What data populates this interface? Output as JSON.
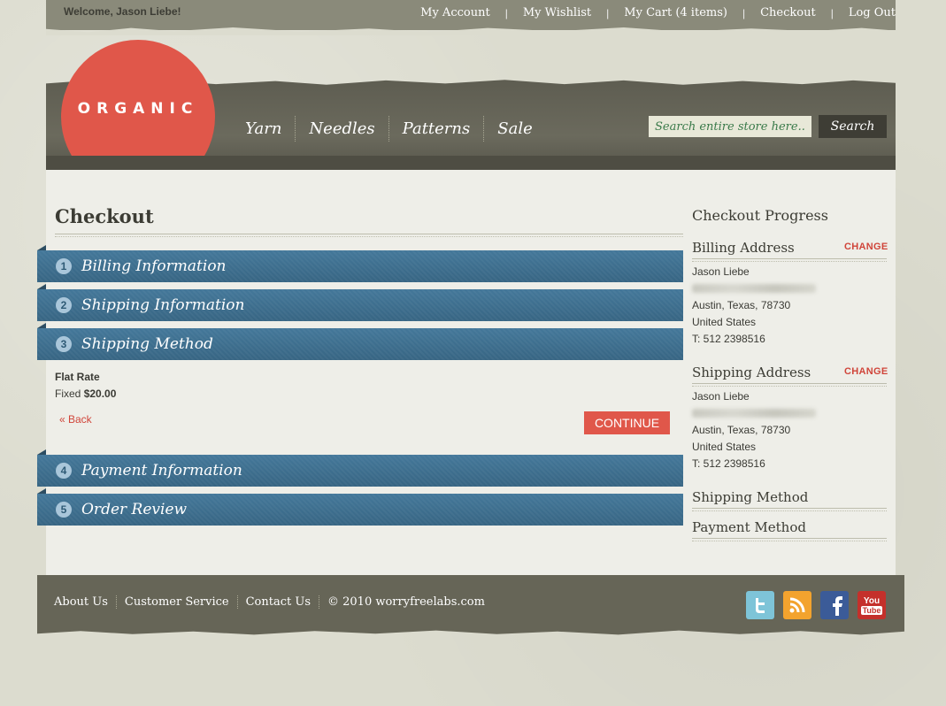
{
  "header": {
    "welcome": "Welcome, Jason Liebe!",
    "top_links": [
      "My Account",
      "My Wishlist",
      "My Cart (4 items)",
      "Checkout",
      "Log Out"
    ],
    "logo_text": "ORGANIC",
    "nav": [
      "Yarn",
      "Needles",
      "Patterns",
      "Sale"
    ],
    "search_placeholder": "Search entire store here...",
    "search_button": "Search"
  },
  "checkout": {
    "title": "Checkout",
    "steps": [
      {
        "num": "1",
        "title": "Billing Information"
      },
      {
        "num": "2",
        "title": "Shipping Information"
      },
      {
        "num": "3",
        "title": "Shipping Method"
      },
      {
        "num": "4",
        "title": "Payment Information"
      },
      {
        "num": "5",
        "title": "Order Review"
      }
    ],
    "method_name": "Flat Rate",
    "method_price_label": "Fixed",
    "method_price": "$20.00",
    "back": "« Back",
    "continue": "CONTINUE"
  },
  "progress": {
    "title": "Checkout Progress",
    "change": "CHANGE",
    "billing": {
      "heading": "Billing Address",
      "name": "Jason Liebe",
      "city": "Austin, Texas, 78730",
      "country": "United States",
      "phone": "T: 512 2398516"
    },
    "shipping": {
      "heading": "Shipping Address",
      "name": "Jason Liebe",
      "city": "Austin, Texas, 78730",
      "country": "United States",
      "phone": "T: 512 2398516"
    },
    "shipping_method": "Shipping Method",
    "payment_method": "Payment Method"
  },
  "footer": {
    "links": [
      "About Us",
      "Customer Service",
      "Contact Us"
    ],
    "copyright": "© 2010 worryfreelabs.com",
    "youtube_top": "You",
    "youtube_bottom": "Tube"
  },
  "colors": {
    "accent_red": "#e0574a",
    "step_blue": "#3e6f8e",
    "header_dark": "#5f5e52"
  }
}
